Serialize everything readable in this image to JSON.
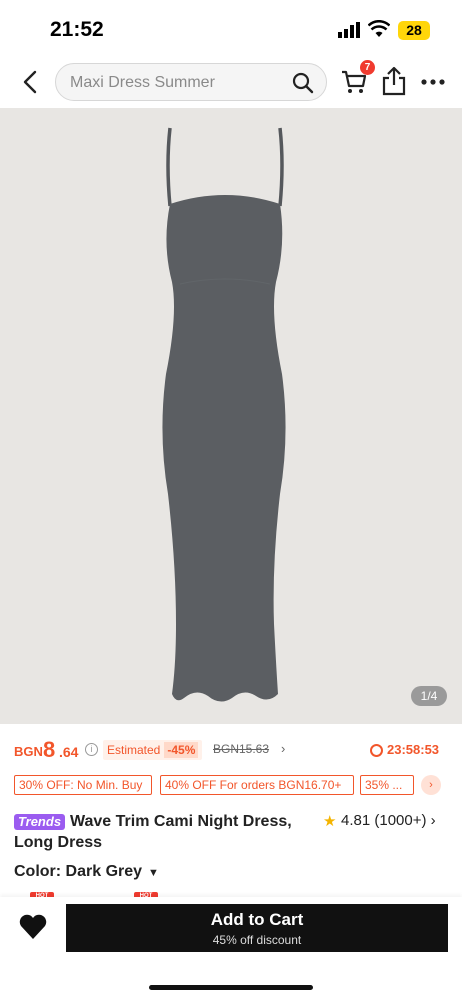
{
  "status": {
    "time": "21:52",
    "battery": "28"
  },
  "nav": {
    "search_placeholder": "Maxi Dress Summer",
    "cart_count": "7"
  },
  "gallery": {
    "counter": "1/4"
  },
  "price": {
    "currency": "BGN",
    "integer": "8",
    "decimal": ".64",
    "estimated_label": "Estimated",
    "discount": "-45%",
    "original": "BGN15.63",
    "countdown": "23:58:53"
  },
  "coupons": [
    "30% OFF: No Min. Buy",
    "40% OFF For orders BGN16.70+",
    "35% ..."
  ],
  "product": {
    "badge": "Trends",
    "title": "Wave Trim Cami Night Dress, Long Dress",
    "rating": "4.81",
    "reviews": "(1000+)",
    "color_label": "Color: Dark Grey"
  },
  "hot_tag": "HOT",
  "cta": {
    "label": "Add to Cart",
    "sub": "45% off discount"
  },
  "colors": {
    "accent": "#f2562b",
    "trends": "#9b5cf0",
    "dress": "#5b5e62",
    "cta": "#111111"
  }
}
